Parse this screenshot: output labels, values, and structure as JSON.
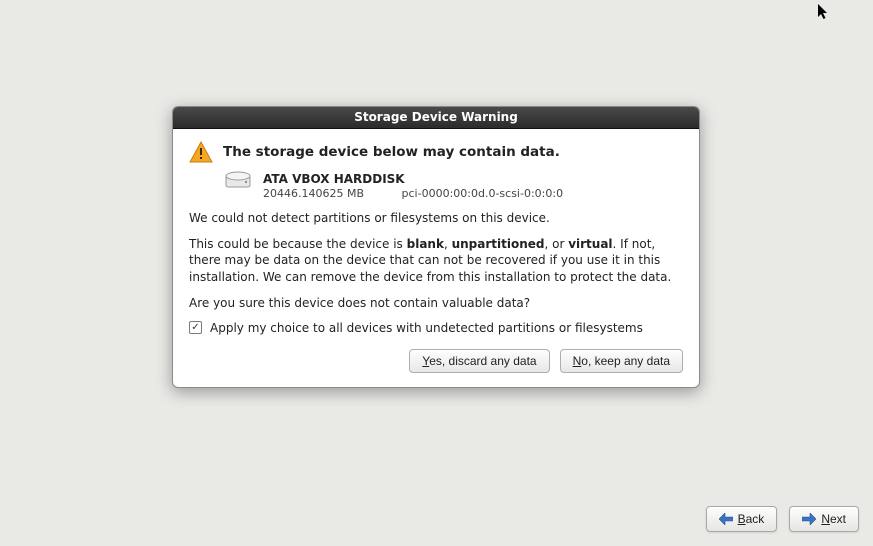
{
  "dialog": {
    "title": "Storage Device Warning",
    "heading": "The storage device below may contain data.",
    "device": {
      "name": "ATA VBOX HARDDISK",
      "size": "20446.140625 MB",
      "path": "pci-0000:00:0d.0-scsi-0:0:0:0"
    },
    "para1": "We could not detect partitions or filesystems on this device.",
    "para2_pre": "This could be because the device is ",
    "para2_b1": "blank",
    "para2_mid1": ", ",
    "para2_b2": "unpartitioned",
    "para2_mid2": ", or ",
    "para2_b3": "virtual",
    "para2_post": ". If not, there may be data on the device that can not be recovered if you use it in this installation. We can remove the device from this installation to protect the data.",
    "para3": "Are you sure this device does not contain valuable data?",
    "checkbox_underline": "A",
    "checkbox_rest": "pply my choice to all devices with undetected partitions or filesystems",
    "buttons": {
      "yes_underline": "Y",
      "yes_rest": "es, discard any data",
      "no_underline": "N",
      "no_rest": "o, keep any data"
    }
  },
  "footer": {
    "back_underline": "B",
    "back_rest": "ack",
    "next_underline": "N",
    "next_rest": "ext"
  }
}
